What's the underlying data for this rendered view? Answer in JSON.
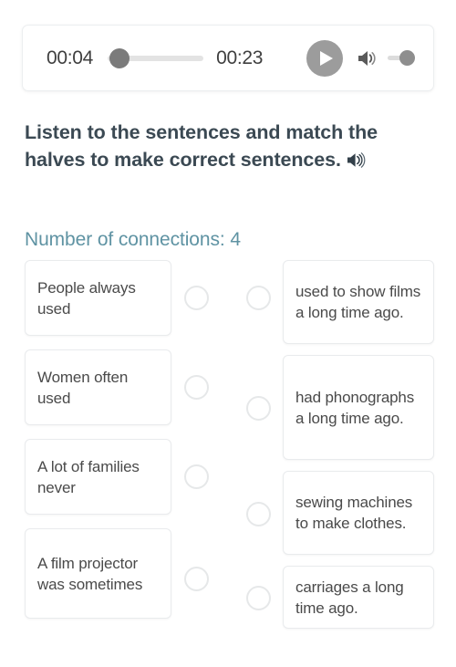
{
  "player": {
    "current_time": "00:04",
    "total_time": "00:23",
    "play_icon": "play-icon",
    "volume_icon": "volume-icon",
    "progress_percent": 17,
    "volume_percent": 100
  },
  "heading": {
    "text": "Listen to the sentences and match the halves to make correct sentences.",
    "speaker_icon": "speaker-icon"
  },
  "connections": {
    "label": "Number of connections: 4",
    "color": "#5f93a3",
    "count": 4
  },
  "match": {
    "left_items": [
      {
        "text": "People always used"
      },
      {
        "text": "Women often used"
      },
      {
        "text": "A lot of families never"
      },
      {
        "text": "A film projector was sometimes"
      }
    ],
    "right_items": [
      {
        "text": "used to show films a long time ago."
      },
      {
        "text": "had phonographs a long time ago."
      },
      {
        "text": "sewing machines to make clothes."
      },
      {
        "text": "carriages a long time ago."
      }
    ]
  }
}
